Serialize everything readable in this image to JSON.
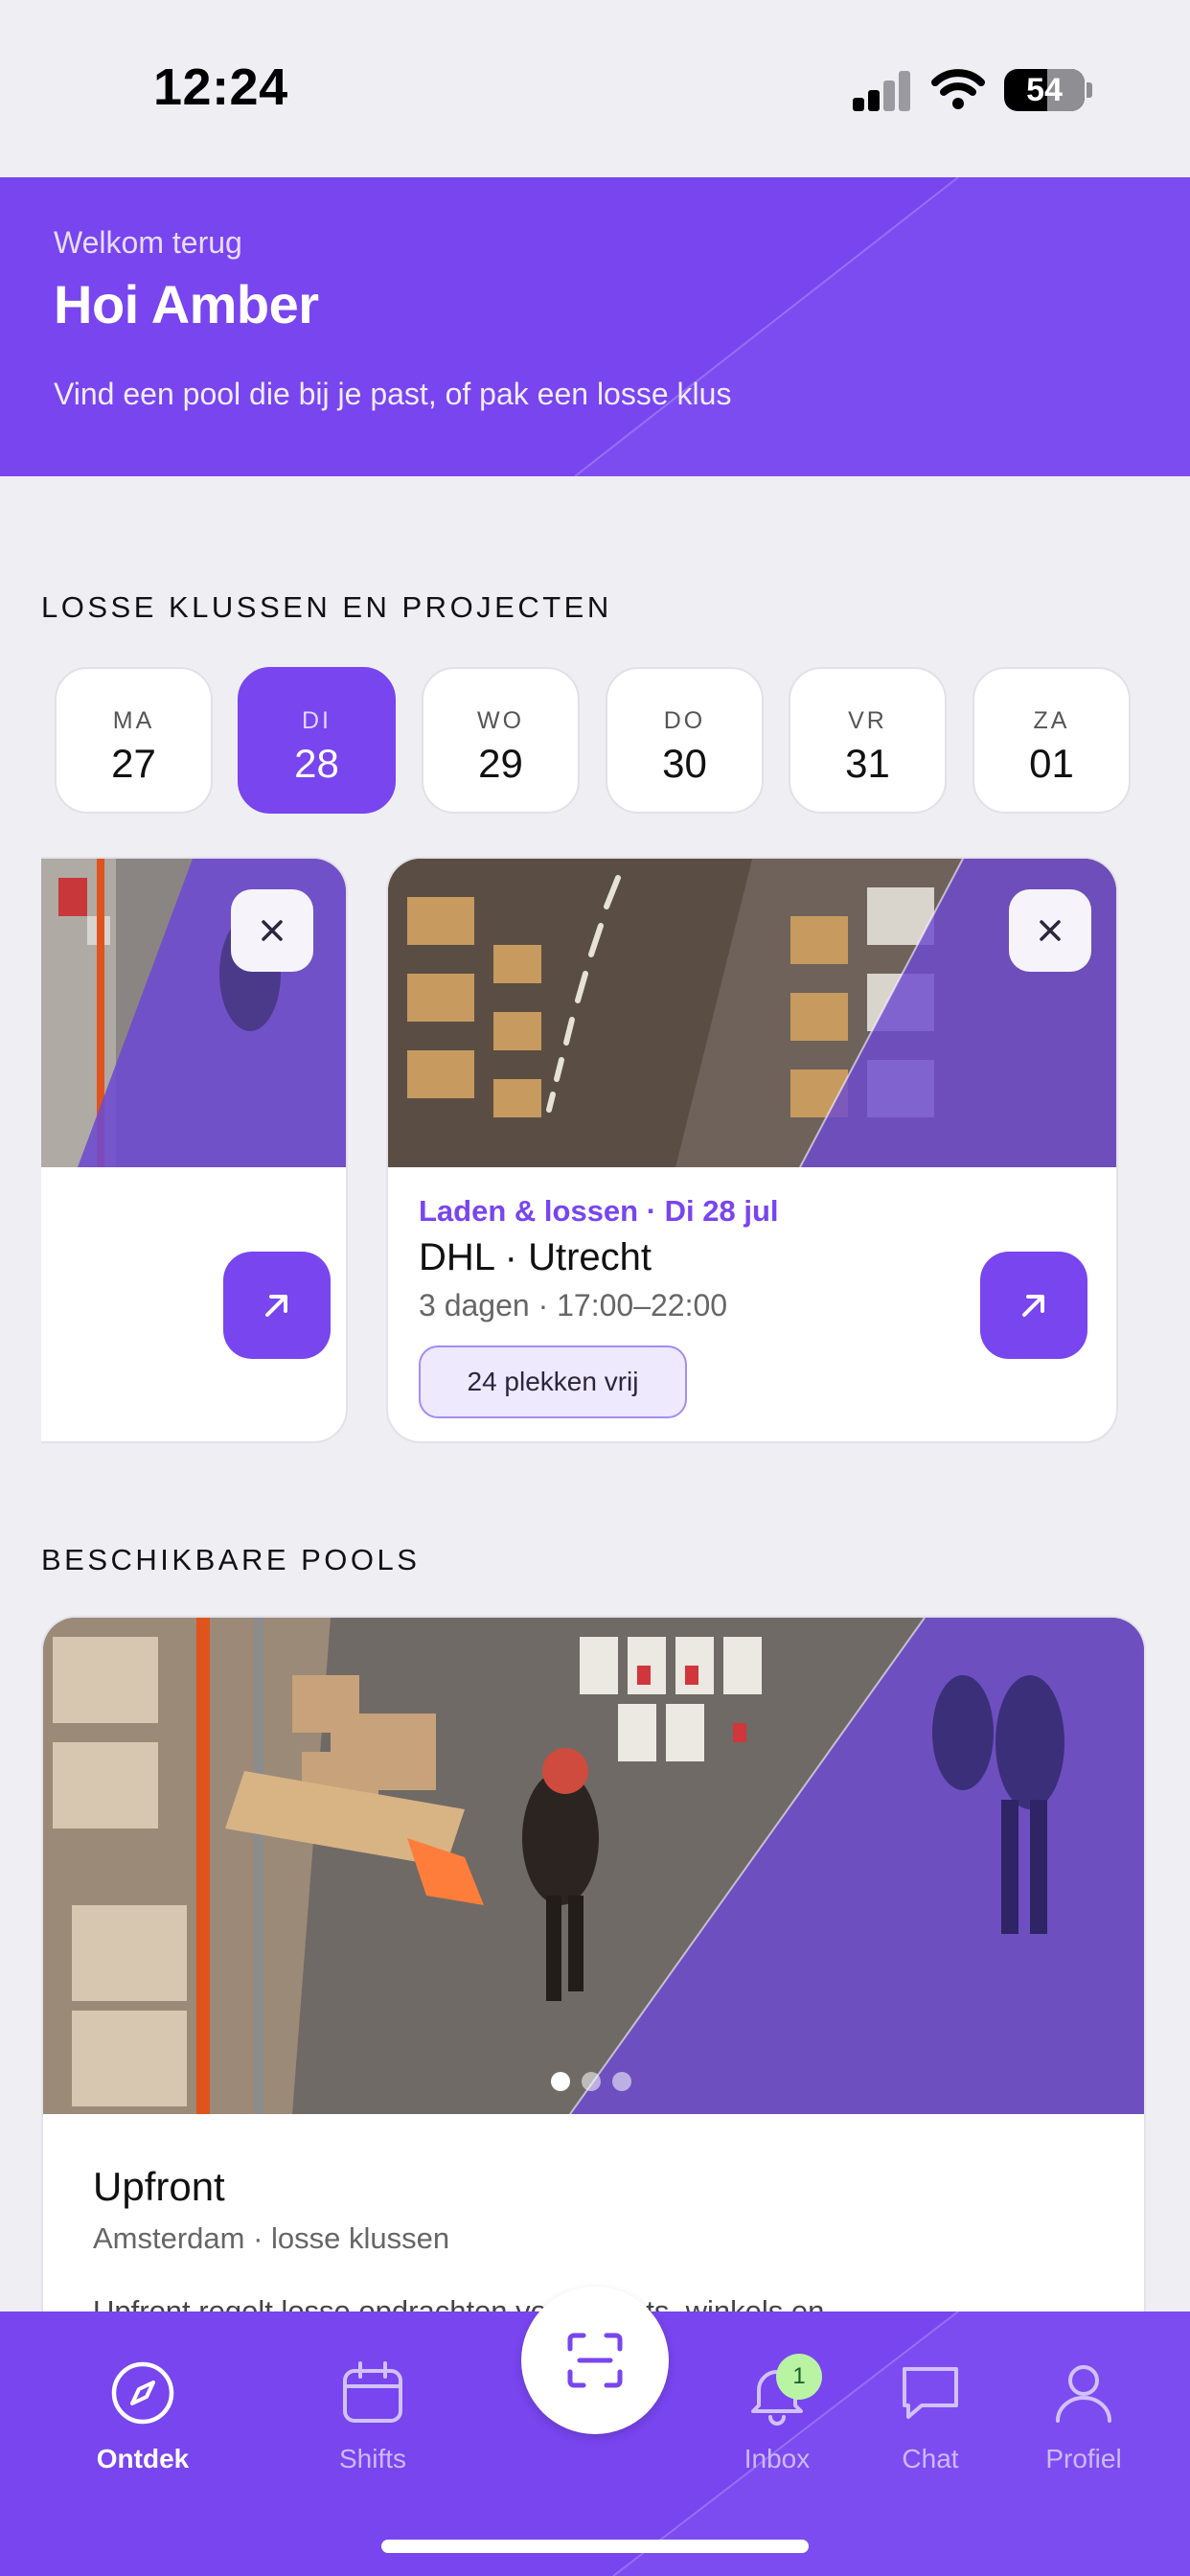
{
  "status_bar": {
    "time": "12:24",
    "battery": "54",
    "battery_level": 0.54
  },
  "hero": {
    "kicker": "Welkom terug",
    "title": "Hoi Amber",
    "subtitle": "Vind een pool die bij je past, of pak een losse klus"
  },
  "jobs_section": {
    "heading": "LOSSE KLUSSEN EN PROJECTEN",
    "days": [
      {
        "abbr": "MA",
        "num": "27",
        "active": false
      },
      {
        "abbr": "DI",
        "num": "28",
        "active": true
      },
      {
        "abbr": "WO",
        "num": "29",
        "active": false
      },
      {
        "abbr": "DO",
        "num": "30",
        "active": false
      },
      {
        "abbr": "VR",
        "num": "31",
        "active": false
      },
      {
        "abbr": "ZA",
        "num": "01",
        "active": false
      }
    ],
    "featured_job": {
      "meta": "Laden & lossen · Di 28 jul",
      "title": "DHL · Utrecht",
      "detail": "3 dagen · 17:00–22:00",
      "badge": "24 plekken vrij"
    }
  },
  "pools_section": {
    "heading": "BESCHIKBARE POOLS",
    "pool": {
      "name": "Upfront",
      "location": "Amsterdam · losse klussen",
      "description": "Upfront regelt losse opdrachten voor events, winkels en"
    }
  },
  "tab_bar": {
    "tabs": [
      {
        "label": "Ontdek",
        "icon": "compass-icon",
        "active": true
      },
      {
        "label": "Shifts",
        "icon": "calendar-icon",
        "active": false
      },
      {
        "label": "Inbox",
        "icon": "bell-icon",
        "active": false,
        "badge": "1"
      },
      {
        "label": "Chat",
        "icon": "chat-bubble-icon",
        "active": false
      },
      {
        "label": "Profiel",
        "icon": "person-icon",
        "active": false
      }
    ],
    "scan_icon": "scan-icon"
  },
  "colors": {
    "brand": "#7845ef",
    "background": "#efeef3",
    "badge_green": "#b9f3a4"
  }
}
